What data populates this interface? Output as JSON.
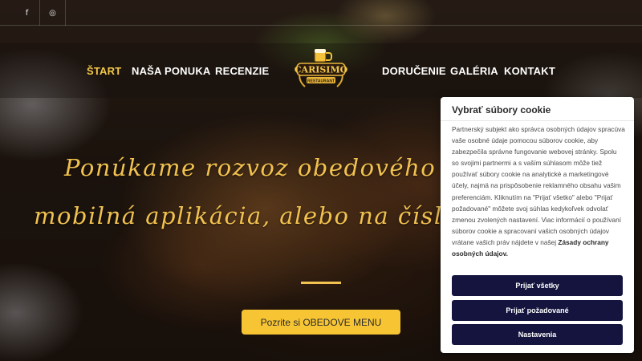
{
  "social": {
    "facebook_glyph": "f",
    "instagram_glyph": "◎"
  },
  "nav": {
    "items": [
      {
        "label": "ŠTART",
        "active": true
      },
      {
        "label": "NAŠA PONUKA",
        "active": false
      },
      {
        "label": "RECENZIE",
        "active": false
      },
      {
        "label": "DORUČENIE",
        "active": false
      },
      {
        "label": "GALÉRIA",
        "active": false
      },
      {
        "label": "KONTAKT",
        "active": false
      }
    ]
  },
  "logo": {
    "name": "CARISIMO",
    "subtitle": "RESTAURANT"
  },
  "hero": {
    "line1": "Ponúkame rozvoz obedového menu",
    "line2": "mobilná aplikácia, alebo na čísle",
    "cta_label": "Pozrite si OBEDOVE MENU"
  },
  "cookie": {
    "title": "Vybrať súbory cookie",
    "text": "Partnerský subjekt ako správca osobných údajov spracúva vaše osobné údaje pomocou súborov cookie, aby zabezpečila správne fungovanie webovej stránky. Spolu so svojimi partnermi a s vaším súhlasom môže tiež používať súbory cookie na analytické a marketingové účely, najmä na prispôsobenie reklamného obsahu vašim preferenciám. Kliknutím na \"Prijať všetko\" alebo \"Prijať požadované\" môžete svoj súhlas kedykoľvek odvolať zmenou zvolených nastavení. Viac informácií o používaní súborov cookie a spracovaní vašich osobných údajov vrátane vašich práv nájdete v našej",
    "link": "Zásady ochrany osobných údajov.",
    "btn_accept_all": "Prijať všetky",
    "btn_accept_required": "Prijať požadované",
    "btn_settings": "Nastavenia"
  },
  "colors": {
    "accent": "#f4c84a",
    "cta": "#f7c534",
    "cookie_button": "#14143f"
  }
}
